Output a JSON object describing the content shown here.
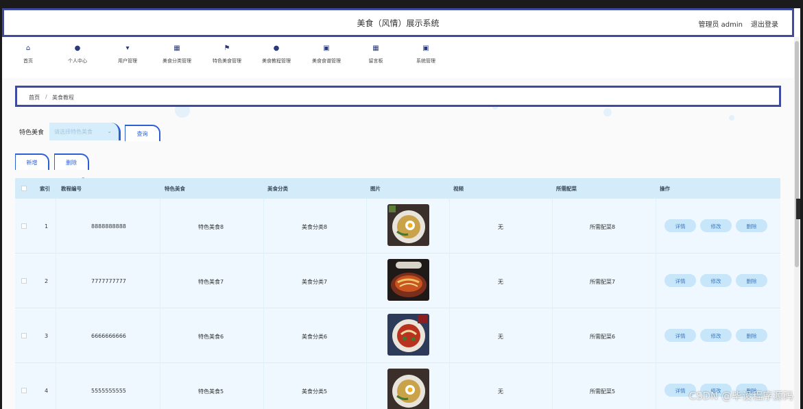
{
  "header": {
    "title": "美食（风情）展示系统",
    "admin": "管理员 admin",
    "logout": "退出登录"
  },
  "nav": [
    {
      "label": "首页",
      "icon": "home-icon"
    },
    {
      "label": "个人中心",
      "icon": "user-icon"
    },
    {
      "label": "用户管理",
      "icon": "users-manage-icon"
    },
    {
      "label": "美食分类管理",
      "icon": "grid-icon"
    },
    {
      "label": "特色美食管理",
      "icon": "flag-icon"
    },
    {
      "label": "美食教程管理",
      "icon": "person-icon"
    },
    {
      "label": "美食食谱管理",
      "icon": "clipboard-icon"
    },
    {
      "label": "留言板",
      "icon": "grid-icon"
    },
    {
      "label": "系统管理",
      "icon": "clipboard-icon"
    }
  ],
  "breadcrumb": {
    "home": "首页",
    "sep": "/",
    "current": "美食教程"
  },
  "filter": {
    "label": "特色美食",
    "placeholder": "请选择特色美食",
    "query_btn": "查询"
  },
  "actions": {
    "add": "新增",
    "delete": "删除"
  },
  "table": {
    "columns": [
      "索引",
      "教程编号",
      "特色美食",
      "美食分类",
      "图片",
      "视频",
      "所需配菜",
      "操作"
    ],
    "rows": [
      {
        "index": "1",
        "code": "8888888888",
        "food": "特色美食8",
        "category": "美食分类8",
        "video": "无",
        "side": "所需配菜8"
      },
      {
        "index": "2",
        "code": "7777777777",
        "food": "特色美食7",
        "category": "美食分类7",
        "video": "无",
        "side": "所需配菜7"
      },
      {
        "index": "3",
        "code": "6666666666",
        "food": "特色美食6",
        "category": "美食分类6",
        "video": "无",
        "side": "所需配菜6"
      },
      {
        "index": "4",
        "code": "5555555555",
        "food": "特色美食5",
        "category": "美食分类5",
        "video": "无",
        "side": "所需配菜5"
      }
    ],
    "op_labels": {
      "detail": "详情",
      "edit": "修改",
      "delete": "删除"
    }
  },
  "watermark": "CSDN @毕设程序源码",
  "colors": {
    "accent": "#2c5fd6",
    "frame": "#3e4aa0",
    "row_bg": "#eef8fe",
    "head_bg": "#d4ecfa",
    "pill_bg": "#c8e6f9"
  }
}
